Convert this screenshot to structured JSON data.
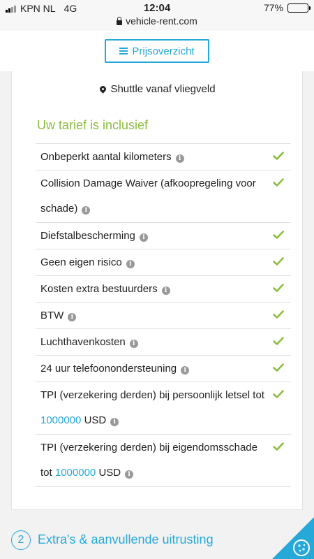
{
  "status_bar": {
    "carrier": "KPN NL",
    "network": "4G",
    "time": "12:04",
    "battery": "77%",
    "battery_level": 0.77
  },
  "browser": {
    "url": "vehicle-rent.com"
  },
  "header": {
    "price_button_label": "Prijsoverzicht"
  },
  "location": {
    "shuttle_text": "Shuttle vanaf vliegveld"
  },
  "inclusive": {
    "heading": "Uw tarief is inclusief",
    "items": [
      {
        "before": "Onbeperkt aantal kilometers"
      },
      {
        "before": "Collision Damage Waiver (afkoopregeling voor schade)"
      },
      {
        "before": "Diefstalbescherming"
      },
      {
        "before": "Geen eigen risico"
      },
      {
        "before": "Kosten extra bestuurders"
      },
      {
        "before": "BTW"
      },
      {
        "before": "Luchthavenkosten"
      },
      {
        "before": "24 uur telefoonondersteuning"
      },
      {
        "before": "TPI (verzekering derden) bij persoonlijk letsel tot",
        "highlight": "1000000",
        "after": "USD"
      },
      {
        "before": "TPI (verzekering derden) bij eigendomsschade tot",
        "highlight": "1000000",
        "after": "USD"
      }
    ]
  },
  "next_step": {
    "number": "2",
    "label": "Extra's & aanvullende uitrusting"
  },
  "colors": {
    "accent": "#26a9d9",
    "green": "#8cbd3f"
  },
  "icons": {
    "info": "info-icon",
    "check": "check-icon",
    "cookie": "cookie-icon"
  }
}
